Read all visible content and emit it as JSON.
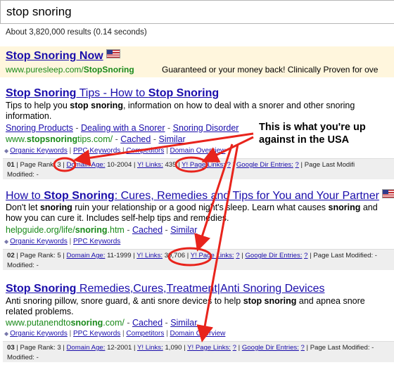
{
  "search": {
    "query": "stop snoring"
  },
  "stats": "About 3,820,000 results (0.14 seconds)",
  "ad": {
    "title_bold": "Stop Snoring",
    "title_rest": " Now",
    "url_plain": "www.puresleep.com/",
    "url_bold": "StopSnoring",
    "description": "Guaranteed or your money back! Clinically Proven for ove"
  },
  "results": [
    {
      "title_html": "<b>Stop Snoring</b> Tips - How to <b>Stop Snoring</b>",
      "snippet_html": "Tips to help you <b>stop snoring</b>, information on how to deal with a snorer and other snoring information.",
      "sitelinks": [
        "Snoring Products",
        "Dealing with a Snorer",
        "Snoring Disorder"
      ],
      "url_html": "www.<b>stopsnoring</b>tips.com/",
      "cached": "Cached",
      "similar": "Similar",
      "tools": [
        "Organic Keywords",
        "PPC Keywords",
        "Competitors",
        "Domain Overview"
      ],
      "num": "01",
      "page_rank": "3",
      "domain_age": "10-2004",
      "y_links": "435",
      "y_page_links": "?",
      "dir_entries": "?"
    },
    {
      "title_html": "How to <b>Stop Snoring</b>: Cures, Remedies and Tips for You and Your Partner",
      "snippet_html": "Don't let <b>snoring</b> ruin your relationship or a good night's sleep. Learn what causes <b>snoring</b> and how you can cure it. Includes self-help tips and remedies.",
      "url_html": "helpguide.org/life/<b>snoring</b>.htm",
      "cached": "Cached",
      "similar": "Similar",
      "tools": [
        "Organic Keywords",
        "PPC Keywords"
      ],
      "num": "02",
      "page_rank": "5",
      "domain_age": "11-1999",
      "y_links": "39,706",
      "y_page_links": "?",
      "dir_entries": "?"
    },
    {
      "title_html": "<b>Stop Snoring</b> Remedies,Cures,Treatment|Anti Snoring Devices",
      "snippet_html": "Anti snoring pillow, snore guard, &amp; anti snore devices to help <b>stop snoring</b> and apnea snore related problems.",
      "url_html": "www.putanendto<b>snoring</b>.com/",
      "cached": "Cached",
      "similar": "Similar",
      "tools": [
        "Organic Keywords",
        "PPC Keywords",
        "Competitors",
        "Domain Overview"
      ],
      "num": "03",
      "page_rank": "3",
      "domain_age": "12-2001",
      "y_links": "1,090",
      "y_page_links": "?",
      "dir_entries": "?"
    }
  ],
  "labels": {
    "page_rank": "Page Rank:",
    "domain_age": "Domain Age:",
    "y_links": "Y! Links:",
    "y_page_links": "Y! Page Links:",
    "dir_entries": "Google Dir Entries:",
    "last_modified_a": "Page Last Modifi",
    "last_modified_b": "Modified: -",
    "last_modified_full": "Page Last Modified: -"
  },
  "annotation": {
    "text": "This is what you're up against in the USA",
    "color": "#e8241c"
  },
  "icons": [
    "us-flag-icon",
    "bullet-icon"
  ]
}
